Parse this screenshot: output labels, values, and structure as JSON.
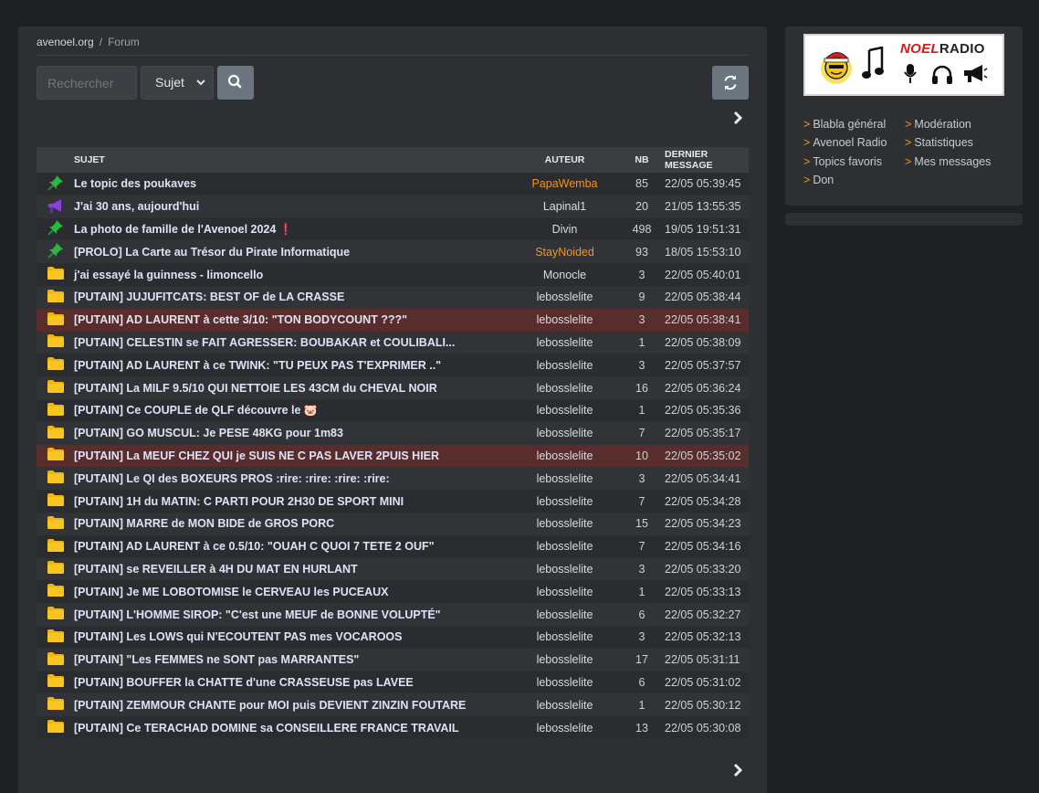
{
  "breadcrumb": {
    "home": "avenoel.org",
    "separator": "/",
    "current": "Forum"
  },
  "search": {
    "placeholder": "Rechercher",
    "select_value": "Sujet"
  },
  "table": {
    "headers": {
      "subject": "SUJET",
      "author": "AUTEUR",
      "nb": "NB",
      "last": "DERNIER MESSAGE"
    },
    "rows": [
      {
        "icon": "pin-icon",
        "title": "Le topic des poukaves",
        "emoji": "",
        "author": "PapaWemba",
        "author_color": "#f7931e",
        "nb": "85",
        "date": "22/05 05:39:45",
        "highlight": false
      },
      {
        "icon": "megaphone-icon",
        "title": "J'ai 30 ans, aujourd'hui",
        "emoji": "",
        "author": "Lapinal1",
        "author_color": "#dadcdf",
        "nb": "20",
        "date": "21/05 13:55:35",
        "highlight": false
      },
      {
        "icon": "pin-icon",
        "title": "La photo de famille de l'Avenoel 2024 ",
        "emoji": "❗",
        "author": "Divin",
        "author_color": "#dadcdf",
        "nb": "498",
        "date": "19/05 19:51:31",
        "highlight": false
      },
      {
        "icon": "pin-icon",
        "title": "[PROLO] La Carte au Trésor du Pirate Informatique",
        "emoji": "",
        "author": "StayNoided",
        "author_color": "#f7931e",
        "nb": "93",
        "date": "18/05 15:53:10",
        "highlight": false
      },
      {
        "icon": "folder-icon",
        "title": "j'ai essayé la guinness - limoncello",
        "emoji": "",
        "author": "Monocle",
        "author_color": "#dadcdf",
        "nb": "3",
        "date": "22/05 05:40:01",
        "highlight": false
      },
      {
        "icon": "folder-icon",
        "title": "[PUTAIN] JUJUFITCATS: BEST OF de LA CRASSE",
        "emoji": "",
        "author": "lebosslelite",
        "author_color": "#dadcdf",
        "nb": "9",
        "date": "22/05 05:38:44",
        "highlight": false
      },
      {
        "icon": "folder-icon",
        "title": "[PUTAIN] AD LAURENT à cette 3/10: \"TON BODYCOUNT ???\"",
        "emoji": "",
        "author": "lebosslelite",
        "author_color": "#dadcdf",
        "nb": "3",
        "date": "22/05 05:38:41",
        "highlight": true
      },
      {
        "icon": "folder-icon",
        "title": "[PUTAIN] CELESTIN se FAIT AGRESSER: BOUBAKAR et COULIBALI...",
        "emoji": "",
        "author": "lebosslelite",
        "author_color": "#dadcdf",
        "nb": "1",
        "date": "22/05 05:38:09",
        "highlight": false
      },
      {
        "icon": "folder-icon",
        "title": "[PUTAIN] AD LAURENT à ce TWINK: \"TU PEUX PAS T'EXPRIMER ..\"",
        "emoji": "",
        "author": "lebosslelite",
        "author_color": "#dadcdf",
        "nb": "3",
        "date": "22/05 05:37:57",
        "highlight": false
      },
      {
        "icon": "folder-icon",
        "title": "[PUTAIN] La MILF 9.5/10 QUI NETTOIE LES 43CM du CHEVAL NOIR",
        "emoji": "",
        "author": "lebosslelite",
        "author_color": "#dadcdf",
        "nb": "16",
        "date": "22/05 05:36:24",
        "highlight": false
      },
      {
        "icon": "folder-icon",
        "title": "[PUTAIN] Ce COUPLE de QLF découvre le ",
        "emoji": "🐷",
        "author": "lebosslelite",
        "author_color": "#dadcdf",
        "nb": "1",
        "date": "22/05 05:35:36",
        "highlight": false
      },
      {
        "icon": "folder-icon",
        "title": "[PUTAIN] GO MUSCUL: Je PESE 48KG pour 1m83",
        "emoji": "",
        "author": "lebosslelite",
        "author_color": "#dadcdf",
        "nb": "7",
        "date": "22/05 05:35:17",
        "highlight": false
      },
      {
        "icon": "folder-icon",
        "title": "[PUTAIN] La MEUF CHEZ QUI je SUIS NE C PAS LAVER 2PUIS HIER",
        "emoji": "",
        "author": "lebosslelite",
        "author_color": "#dadcdf",
        "nb": "10",
        "date": "22/05 05:35:02",
        "highlight": true
      },
      {
        "icon": "folder-icon",
        "title": "[PUTAIN] Le QI des BOXEURS PROS :rire: :rire: :rire: :rire:",
        "emoji": "",
        "author": "lebosslelite",
        "author_color": "#dadcdf",
        "nb": "3",
        "date": "22/05 05:34:41",
        "highlight": false
      },
      {
        "icon": "folder-icon",
        "title": "[PUTAIN] 1H du MATIN: C PARTI POUR 2H30 DE SPORT MINI",
        "emoji": "",
        "author": "lebosslelite",
        "author_color": "#dadcdf",
        "nb": "7",
        "date": "22/05 05:34:28",
        "highlight": false
      },
      {
        "icon": "folder-icon",
        "title": "[PUTAIN] MARRE de MON BIDE de GROS PORC",
        "emoji": "",
        "author": "lebosslelite",
        "author_color": "#dadcdf",
        "nb": "15",
        "date": "22/05 05:34:23",
        "highlight": false
      },
      {
        "icon": "folder-icon",
        "title": "[PUTAIN] AD LAURENT à ce 0.5/10: \"OUAH C QUOI 7 TETE 2 OUF\"",
        "emoji": "",
        "author": "lebosslelite",
        "author_color": "#dadcdf",
        "nb": "7",
        "date": "22/05 05:34:16",
        "highlight": false
      },
      {
        "icon": "folder-icon",
        "title": "[PUTAIN] se REVEILLER à 4H DU MAT EN HURLANT",
        "emoji": "",
        "author": "lebosslelite",
        "author_color": "#dadcdf",
        "nb": "3",
        "date": "22/05 05:33:20",
        "highlight": false
      },
      {
        "icon": "folder-icon",
        "title": "[PUTAIN] Je ME LOBOTOMISE le CERVEAU les PUCEAUX",
        "emoji": "",
        "author": "lebosslelite",
        "author_color": "#dadcdf",
        "nb": "1",
        "date": "22/05 05:33:13",
        "highlight": false
      },
      {
        "icon": "folder-icon",
        "title": "[PUTAIN] L'HOMME SIROP: \"C'est une MEUF de BONNE VOLUPTÉ\"",
        "emoji": "",
        "author": "lebosslelite",
        "author_color": "#dadcdf",
        "nb": "6",
        "date": "22/05 05:32:27",
        "highlight": false
      },
      {
        "icon": "folder-icon",
        "title": "[PUTAIN] Les LOWS qui N'ECOUTENT PAS mes VOCAROOS",
        "emoji": "",
        "author": "lebosslelite",
        "author_color": "#dadcdf",
        "nb": "3",
        "date": "22/05 05:32:13",
        "highlight": false
      },
      {
        "icon": "folder-icon",
        "title": "[PUTAIN] \"Les FEMMES ne SONT pas MARRANTES\"",
        "emoji": "",
        "author": "lebosslelite",
        "author_color": "#dadcdf",
        "nb": "17",
        "date": "22/05 05:31:11",
        "highlight": false
      },
      {
        "icon": "folder-icon",
        "title": "[PUTAIN] BOUFFER la CHATTE d'une CRASSEUSE pas LAVEE",
        "emoji": "",
        "author": "lebosslelite",
        "author_color": "#dadcdf",
        "nb": "6",
        "date": "22/05 05:31:02",
        "highlight": false
      },
      {
        "icon": "folder-icon",
        "title": "[PUTAIN] ZEMMOUR CHANTE pour MOI puis DEVIENT ZINZIN FOUTARE",
        "emoji": "",
        "author": "lebosslelite",
        "author_color": "#dadcdf",
        "nb": "1",
        "date": "22/05 05:30:12",
        "highlight": false
      },
      {
        "icon": "folder-icon",
        "title": "[PUTAIN] Ce TERACHAD DOMINE sa CONSEILLERE FRANCE TRAVAIL",
        "emoji": "",
        "author": "lebosslelite",
        "author_color": "#dadcdf",
        "nb": "13",
        "date": "22/05 05:30:08",
        "highlight": false
      }
    ]
  },
  "sidebar": {
    "radio": {
      "noel": "NOEL",
      "radio": "RADIO"
    },
    "links_left": [
      "Blabla général",
      "Avenoel Radio",
      "Topics favoris",
      "Don"
    ],
    "links_right": [
      "Modération",
      "Statistiques",
      "Mes messages"
    ],
    "bullet": ">"
  },
  "colors": {
    "accent": "#f7931e",
    "highlight_row": "#5a2d2d",
    "button": "#6b7580"
  }
}
